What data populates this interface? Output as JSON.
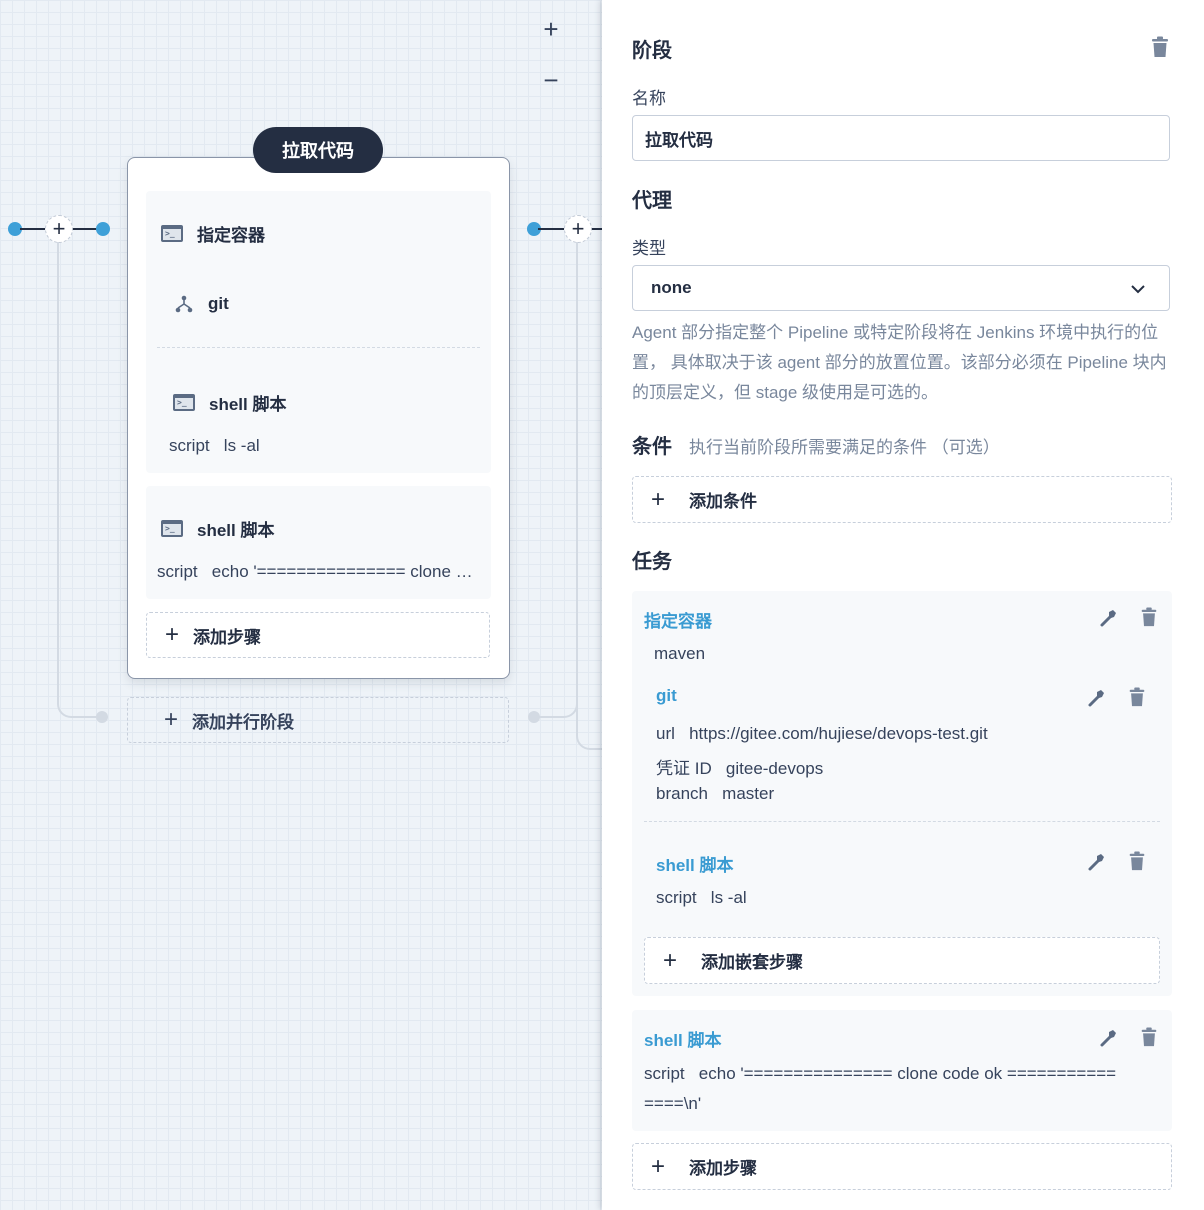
{
  "canvas": {
    "zoom_in_label": "+",
    "zoom_out_label": "−",
    "stage": {
      "title": "拉取代码",
      "steps": [
        {
          "name": "指定容器",
          "icon": "terminal-icon"
        },
        {
          "name": "git",
          "icon": "git-branch-icon"
        },
        {
          "name": "shell 脚本",
          "icon": "terminal-icon",
          "param_key": "script",
          "param_value": "ls -al"
        },
        {
          "name": "shell 脚本",
          "icon": "terminal-icon",
          "param_key": "script",
          "param_value": "echo '=============== clone code ok ===============\\n'"
        }
      ],
      "add_step_label": "添加步骤"
    },
    "add_parallel_stage_label": "添加并行阶段"
  },
  "panel": {
    "section_stage": "阶段",
    "name_label": "名称",
    "name_value": "拉取代码",
    "section_agent": "代理",
    "type_label": "类型",
    "type_value": "none",
    "agent_description": "Agent 部分指定整个 Pipeline 或特定阶段将在 Jenkins 环境中执行的位置， 具体取决于该 agent 部分的放置位置。该部分必须在 Pipeline 块内的顶层定义，但 stage 级使用是可选的。",
    "section_condition": "条件",
    "condition_hint": "执行当前阶段所需要满足的条件 （可选）",
    "add_condition_label": "添加条件",
    "section_tasks": "任务",
    "tasks": [
      {
        "name": "指定容器",
        "value": "maven",
        "nested": [
          {
            "name": "git",
            "params": [
              {
                "key": "url",
                "value": "https://gitee.com/hujiese/devops-test.git"
              },
              {
                "key": "凭证 ID",
                "value": "gitee-devops"
              },
              {
                "key": "branch",
                "value": "master"
              }
            ]
          },
          {
            "name": "shell 脚本",
            "params": [
              {
                "key": "script",
                "value": "ls -al"
              }
            ]
          }
        ],
        "add_nested_label": "添加嵌套步骤"
      },
      {
        "name": "shell 脚本",
        "params": [
          {
            "key": "script",
            "value": "echo '=============== clone code ok ===========",
            "value_cont": "====\\n'"
          }
        ]
      }
    ],
    "add_step_label": "添加步骤"
  },
  "colors": {
    "dark": "#242e42",
    "accent": "#3a9bd2",
    "dot": "#3ea0d8",
    "muted": "#79879c"
  }
}
